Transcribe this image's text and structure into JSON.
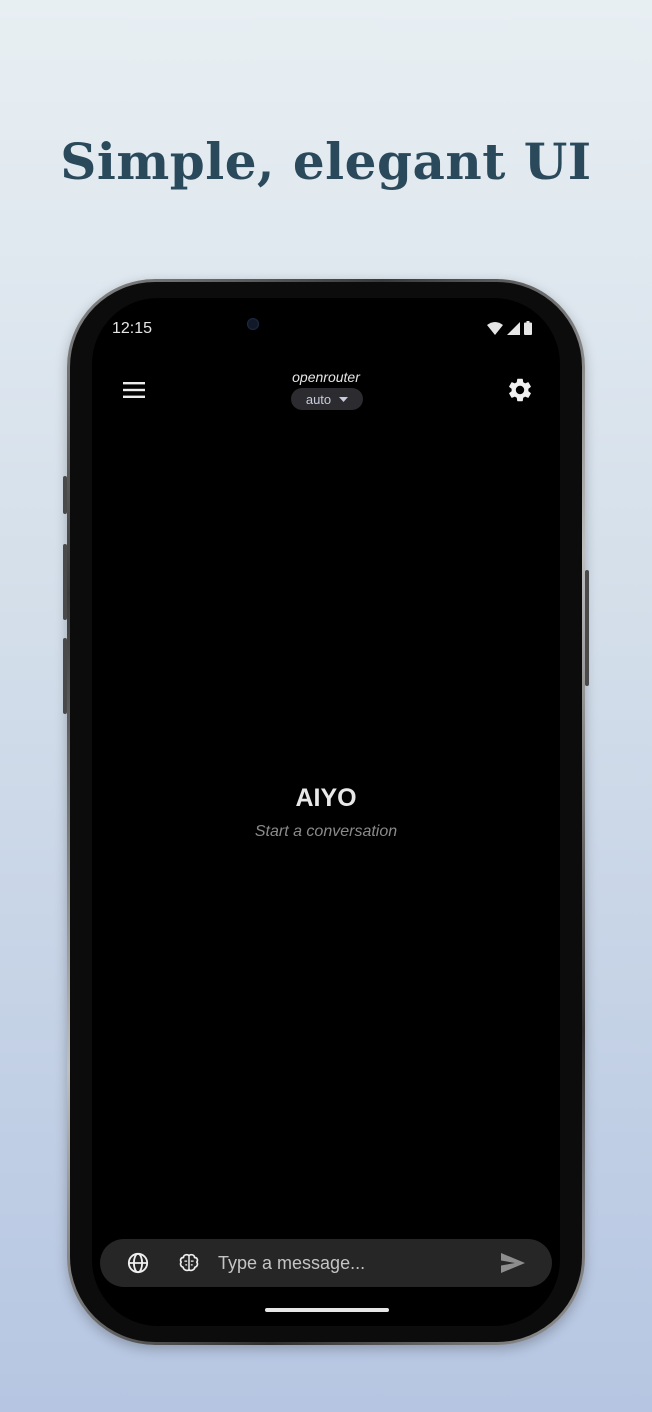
{
  "promo": {
    "headline": "Simple, elegant UI"
  },
  "status_bar": {
    "time": "12:15",
    "icons": [
      "wifi-icon",
      "signal-icon",
      "battery-icon"
    ]
  },
  "app_bar": {
    "provider": "openrouter",
    "model": "auto",
    "menu_icon": "menu-icon",
    "settings_icon": "gear-icon"
  },
  "empty_state": {
    "app_name": "AIYO",
    "subtitle": "Start a conversation"
  },
  "composer": {
    "placeholder": "Type a message...",
    "value": "",
    "left_icons": [
      "globe-icon",
      "brain-icon"
    ],
    "send_icon": "send-icon"
  },
  "colors": {
    "background_top": "#e8eff3",
    "background_bottom": "#b6c6e2",
    "headline": "#2a4a5c",
    "screen": "#000000",
    "input_bar": "#262626"
  }
}
